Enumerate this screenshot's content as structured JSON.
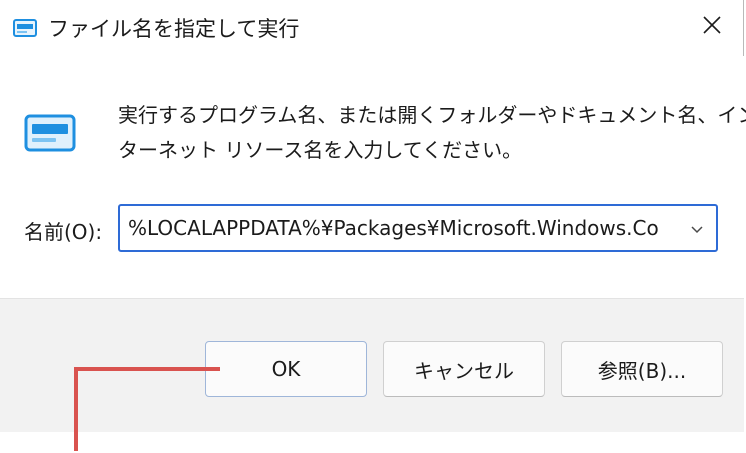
{
  "window": {
    "title": "ファイル名を指定して実行",
    "title_icon": "run-app-icon",
    "close_icon": "close-icon"
  },
  "content": {
    "icon": "run-app-icon",
    "message_line1": "実行するプログラム名、または開くフォルダーやドキュメント名、イン",
    "message_line2": "ターネット リソース名を入力してください。",
    "name_label": "名前(O):",
    "name_value": "%LOCALAPPDATA%¥Packages¥Microsoft.Windows.Co",
    "dropdown_icon": "chevron-down-icon"
  },
  "buttons": {
    "ok": "OK",
    "cancel": "キャンセル",
    "browse": "参照(B)..."
  },
  "colors": {
    "accent": "#2e6bd6",
    "callout": "#d9534f",
    "footer_bg": "#f2f2f2",
    "icon_blue": "#1e8fe0"
  }
}
